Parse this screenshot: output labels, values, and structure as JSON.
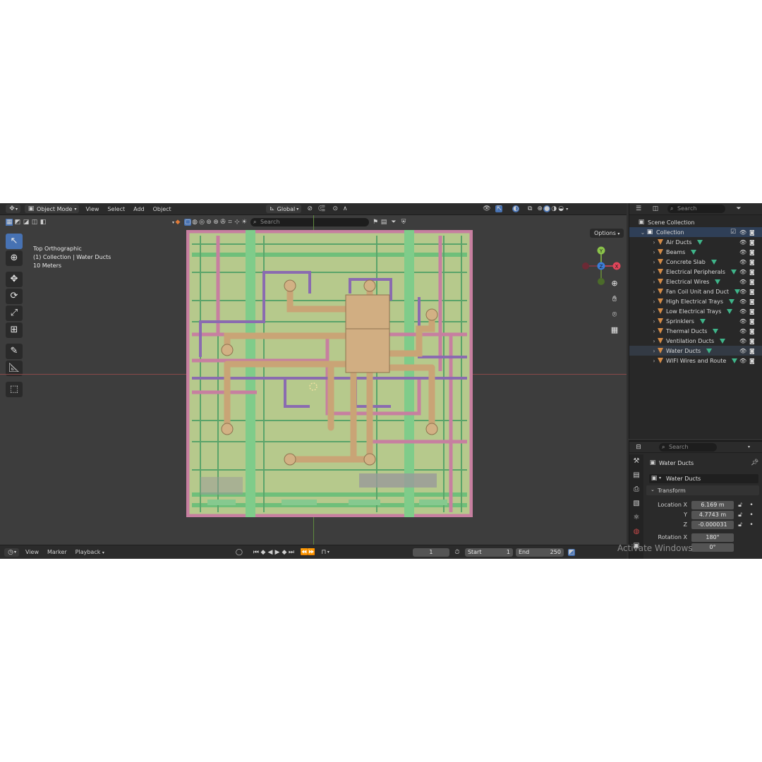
{
  "header": {
    "mode_label": "Object Mode",
    "menus": [
      "View",
      "Select",
      "Add",
      "Object"
    ],
    "orientation_label": "Global",
    "header_search_placeholder": "Search",
    "options_label": "Options"
  },
  "viewport": {
    "view_name": "Top Orthographic",
    "collection_line": "(1) Collection | Water Ducts",
    "scale_text": "10 Meters",
    "gizmo": {
      "y": "Y",
      "z": "Z",
      "x": "X"
    }
  },
  "timeline": {
    "menus": [
      "View",
      "Marker"
    ],
    "playback_label": "Playback",
    "current_frame": "1",
    "start_label": "Start",
    "start_value": "1",
    "end_label": "End",
    "end_value": "250"
  },
  "outliner": {
    "search_placeholder": "Search",
    "scene_collection": "Scene Collection",
    "collection": "Collection",
    "items": [
      {
        "label": "Air Ducts"
      },
      {
        "label": "Beams"
      },
      {
        "label": "Concrete Slab"
      },
      {
        "label": "Electrical Peripherals"
      },
      {
        "label": "Electrical Wires"
      },
      {
        "label": "Fan Coil Unit and Duct"
      },
      {
        "label": "High Electrical Trays"
      },
      {
        "label": "Low Electrical Trays"
      },
      {
        "label": "Sprinklers"
      },
      {
        "label": "Thermal Ducts"
      },
      {
        "label": "Ventilation Ducts"
      },
      {
        "label": "Water Ducts"
      },
      {
        "label": "WIFI Wires and Route"
      }
    ],
    "selected_item": "Water Ducts"
  },
  "properties": {
    "search_placeholder": "Search",
    "object_name": "Water Ducts",
    "datablock_name": "Water Ducts",
    "panel_title": "Transform",
    "location_label": "Location X",
    "loc_x": "6.169 m",
    "y_label": "Y",
    "loc_y": "4.7743 m",
    "z_label": "Z",
    "loc_z": "-0.000031",
    "rotation_label": "Rotation X",
    "rot_x": "180°",
    "rot_y": "0°"
  },
  "watermark": "Activate Windows",
  "colors": {
    "accent": "#4772b3",
    "slab": "#b6c98c",
    "pipe_green": "#6fbf7a",
    "pipe_pink": "#c77fa0",
    "pipe_purple": "#8a6bb0",
    "duct_tan": "#c9a476"
  }
}
